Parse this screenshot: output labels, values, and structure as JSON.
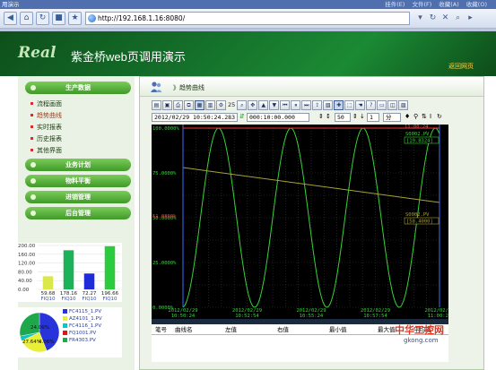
{
  "browser": {
    "title": "用演示",
    "menu": [
      "挂件(E)",
      "文件(F)",
      "收藏(A)",
      "收藏(O)"
    ],
    "address": "http://192.168.1.16:8080/"
  },
  "banner": {
    "logo": "Real",
    "brand": "紫金桥web页调用演示",
    "back_link": "返回网页"
  },
  "sidebar": {
    "sections": [
      {
        "label": "生产数据"
      },
      {
        "label": "业务计划"
      },
      {
        "label": "物料平衡"
      },
      {
        "label": "进销管理"
      },
      {
        "label": "后台管理"
      }
    ],
    "subitems": [
      {
        "label": "流程画面"
      },
      {
        "label": "趋势曲线"
      },
      {
        "label": "实时报表"
      },
      {
        "label": "历史报表"
      },
      {
        "label": "其他界面"
      }
    ]
  },
  "mini_bar": {
    "y_ticks": [
      "200.00",
      "160.00",
      "120.00",
      "80.00",
      "40.00",
      "0.00"
    ],
    "value_labels": [
      "59.68",
      "178.16",
      "72.27",
      "196.66"
    ],
    "categories": [
      "FIQ10",
      "FIQ10",
      "FIQ10",
      "FIQ10"
    ],
    "colors": [
      "#d9e84c",
      "#1db25a",
      "#1f2bd9",
      "#2acb3c"
    ]
  },
  "mini_pie": {
    "labels": [
      "24.06%",
      "27.64%",
      "4.06%"
    ],
    "legend": [
      {
        "name": "FC4115_1.PV",
        "color": "#2734d9"
      },
      {
        "name": "AZ4101_1.PV",
        "color": "#e8ef36"
      },
      {
        "name": "FC4116_1.PV",
        "color": "#13c1c7"
      },
      {
        "name": "FQ1001.PV",
        "color": "#d21c1c"
      },
      {
        "name": "FR4303.PV",
        "color": "#1ea84b"
      }
    ]
  },
  "main": {
    "title": "》趋势曲线",
    "toolbar_num1": "25",
    "start_time": "2012/02/29  10:50:24.283",
    "span": "000:10:00.000",
    "step": "50",
    "step2": "1",
    "unit": "分"
  },
  "chart_data": {
    "type": "line",
    "y_labels": [
      "100.0000%",
      "75.0000%",
      "50.0000%",
      "25.0000%",
      "0.0000%"
    ],
    "y_right_top": "11:00:24",
    "x_ticks": [
      {
        "date": "2012/02/29",
        "time": "10:50:24"
      },
      {
        "date": "2012/02/29",
        "time": "10:52:54"
      },
      {
        "date": "2012/02/29",
        "time": "10:55:24"
      },
      {
        "date": "2012/02/29",
        "time": "10:57:54"
      },
      {
        "date": "2012/02/29",
        "time": "11:00:24"
      }
    ],
    "marker_left": "51.0800%",
    "series": [
      {
        "name": "S0002.PV",
        "value": "[19.8324]",
        "color": "#38d23a"
      },
      {
        "name": "S0002.PV",
        "value": "[58.4000]",
        "color": "#a8a235"
      }
    ]
  },
  "table": {
    "headers": [
      "笔号",
      "曲线名",
      "左值",
      "右值",
      "最小值",
      "最大值",
      "平均值"
    ]
  },
  "watermark": {
    "line1": "中华工控网",
    "line2": "gkong.com"
  }
}
